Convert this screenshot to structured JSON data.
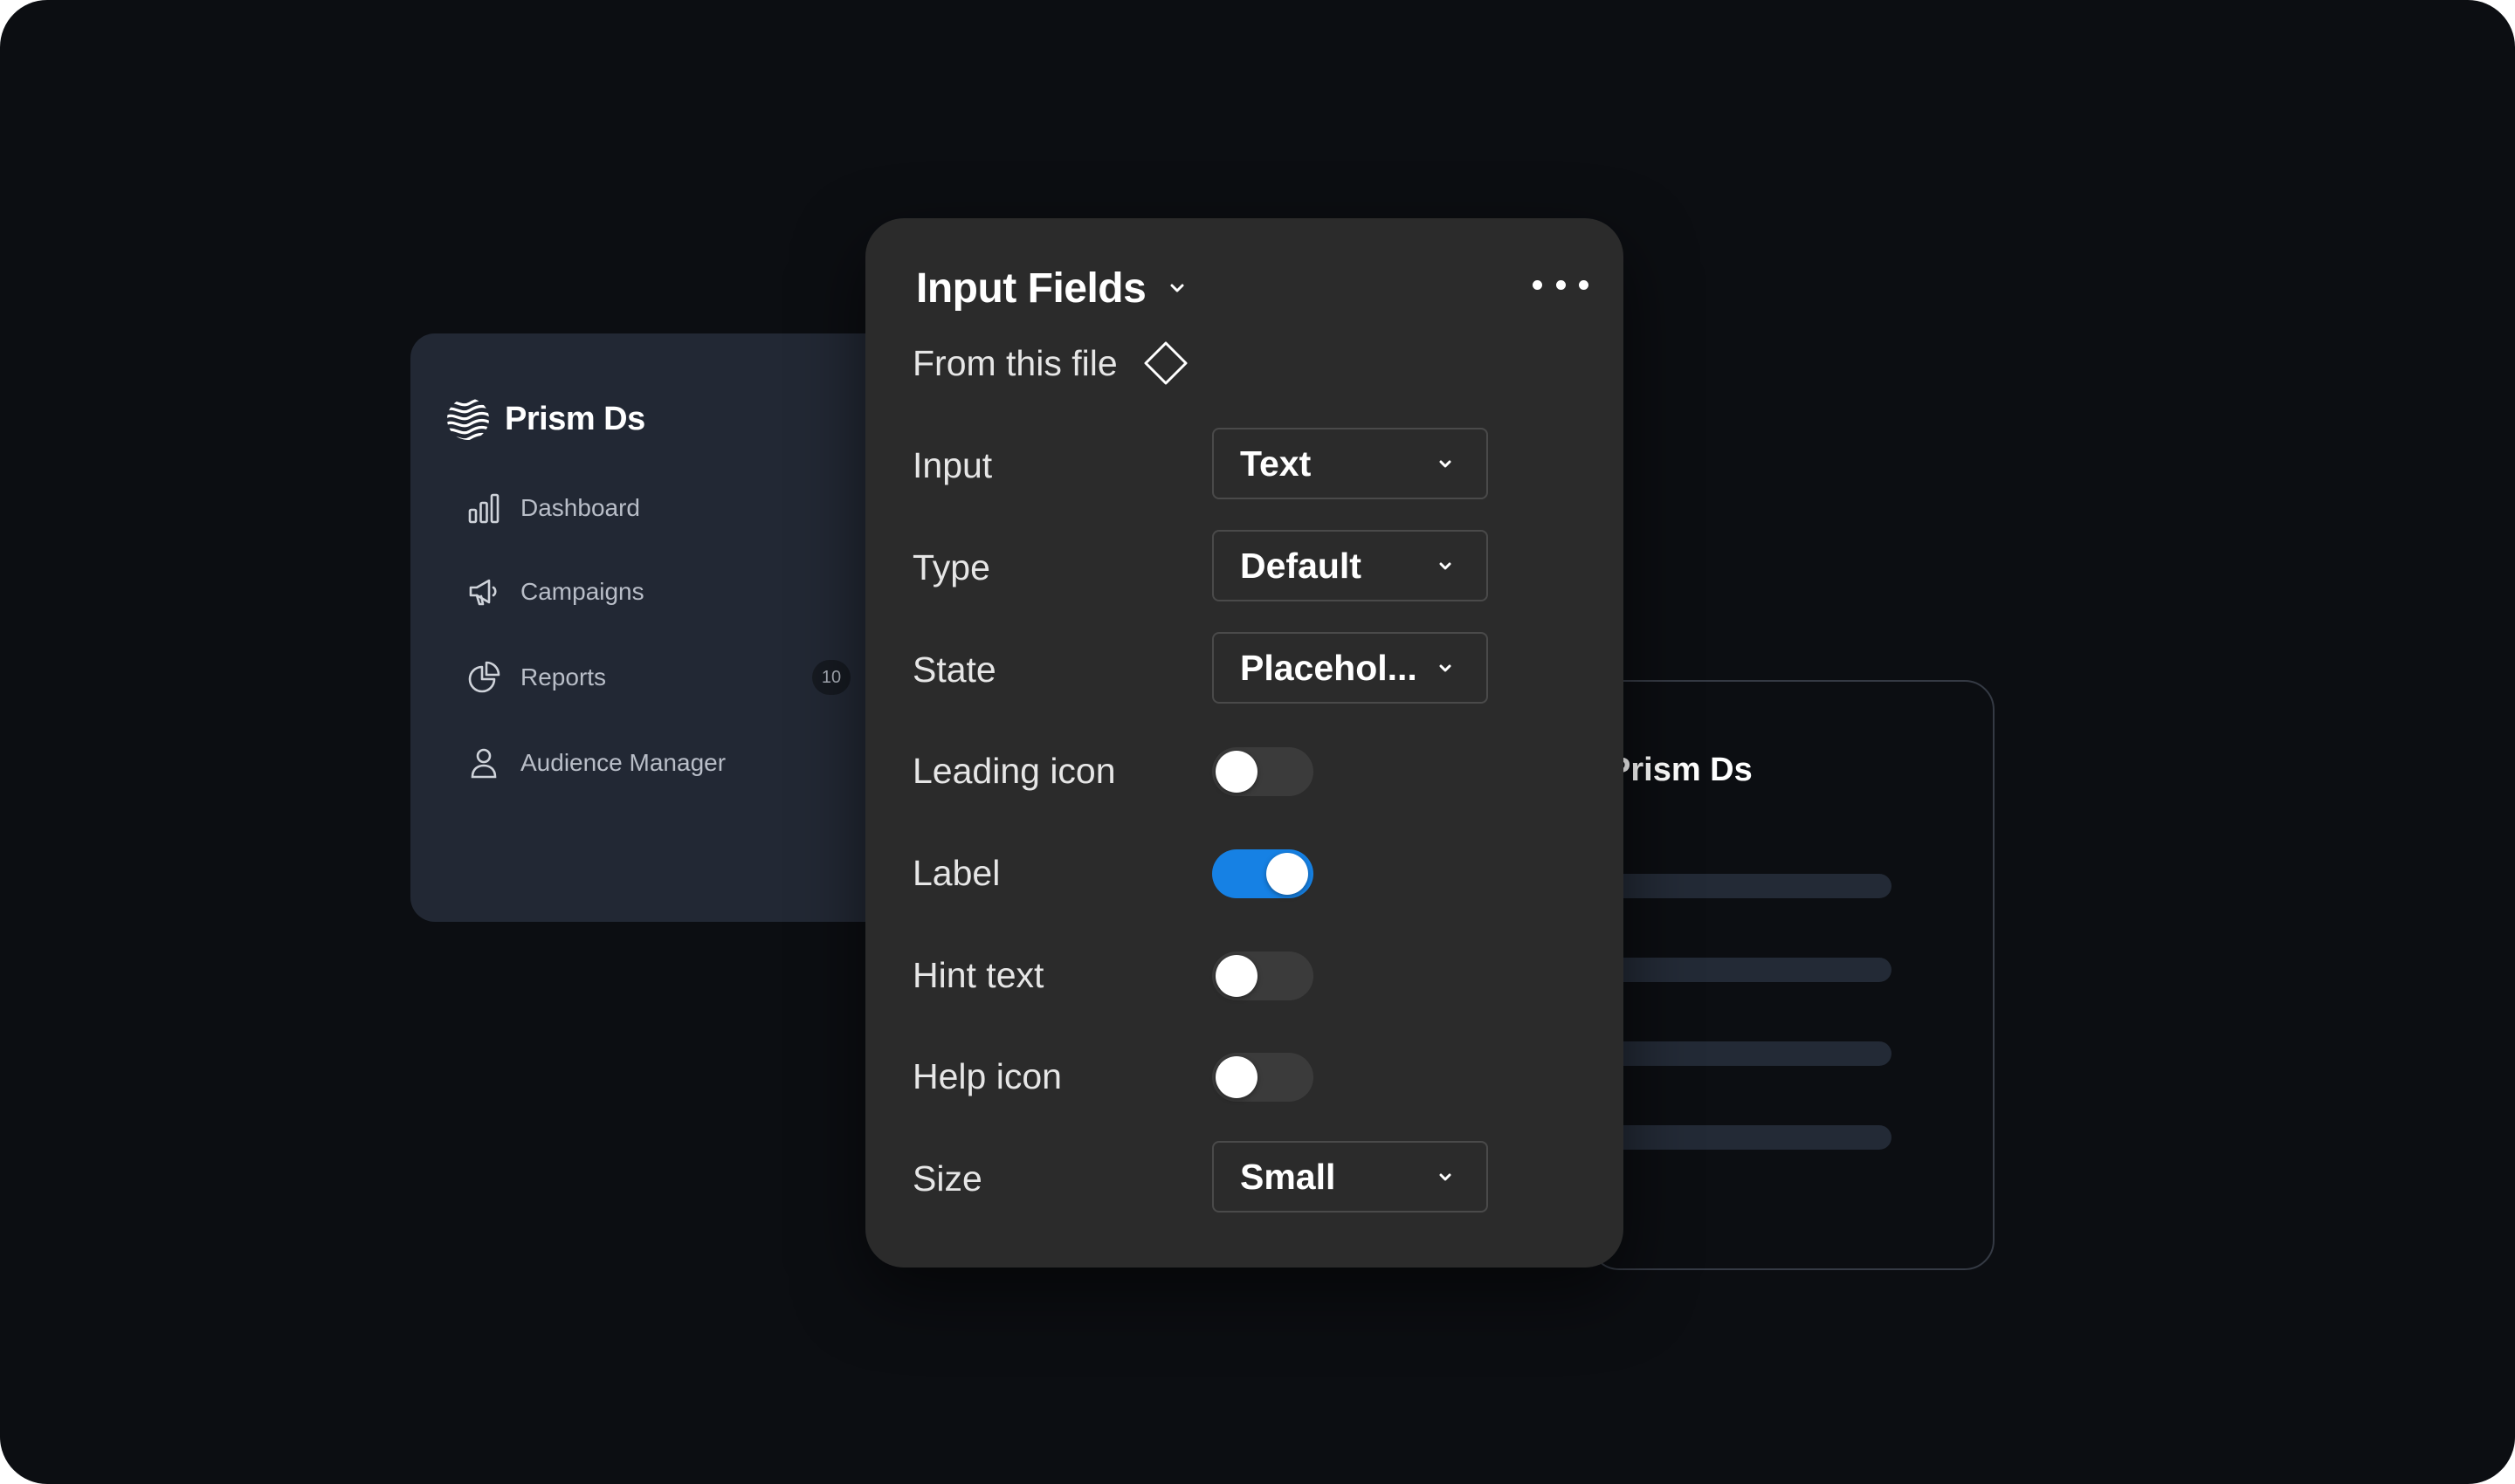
{
  "sidebar": {
    "brand": "Prism Ds",
    "brand_icon": "wave-logo-icon",
    "items": [
      {
        "label": "Dashboard",
        "icon": "bar-chart-icon"
      },
      {
        "label": "Campaigns",
        "icon": "megaphone-icon"
      },
      {
        "label": "Reports",
        "icon": "pie-chart-icon",
        "badge": "10"
      },
      {
        "label": "Audience Manager",
        "icon": "user-icon"
      }
    ]
  },
  "preview": {
    "title": "Prism Ds"
  },
  "panel": {
    "title": "Input Fields",
    "source_label": "From this file",
    "source_icon": "component-diamond-icon",
    "more_icon": "more-horizontal-icon",
    "properties": [
      {
        "label": "Input",
        "kind": "select",
        "value": "Text"
      },
      {
        "label": "Type",
        "kind": "select",
        "value": "Default"
      },
      {
        "label": "State",
        "kind": "select",
        "value": "Placehol..."
      },
      {
        "label": "Leading icon",
        "kind": "toggle",
        "on": false
      },
      {
        "label": "Label",
        "kind": "toggle",
        "on": true
      },
      {
        "label": "Hint text",
        "kind": "toggle",
        "on": false
      },
      {
        "label": "Help icon",
        "kind": "toggle",
        "on": false
      },
      {
        "label": "Size",
        "kind": "select",
        "value": "Small"
      }
    ]
  },
  "colors": {
    "background": "#0c0e12",
    "sidebar": "#222834",
    "panel": "#2b2b2b",
    "toggle_on": "#1681e4",
    "toggle_off": "#3b3b3b"
  }
}
